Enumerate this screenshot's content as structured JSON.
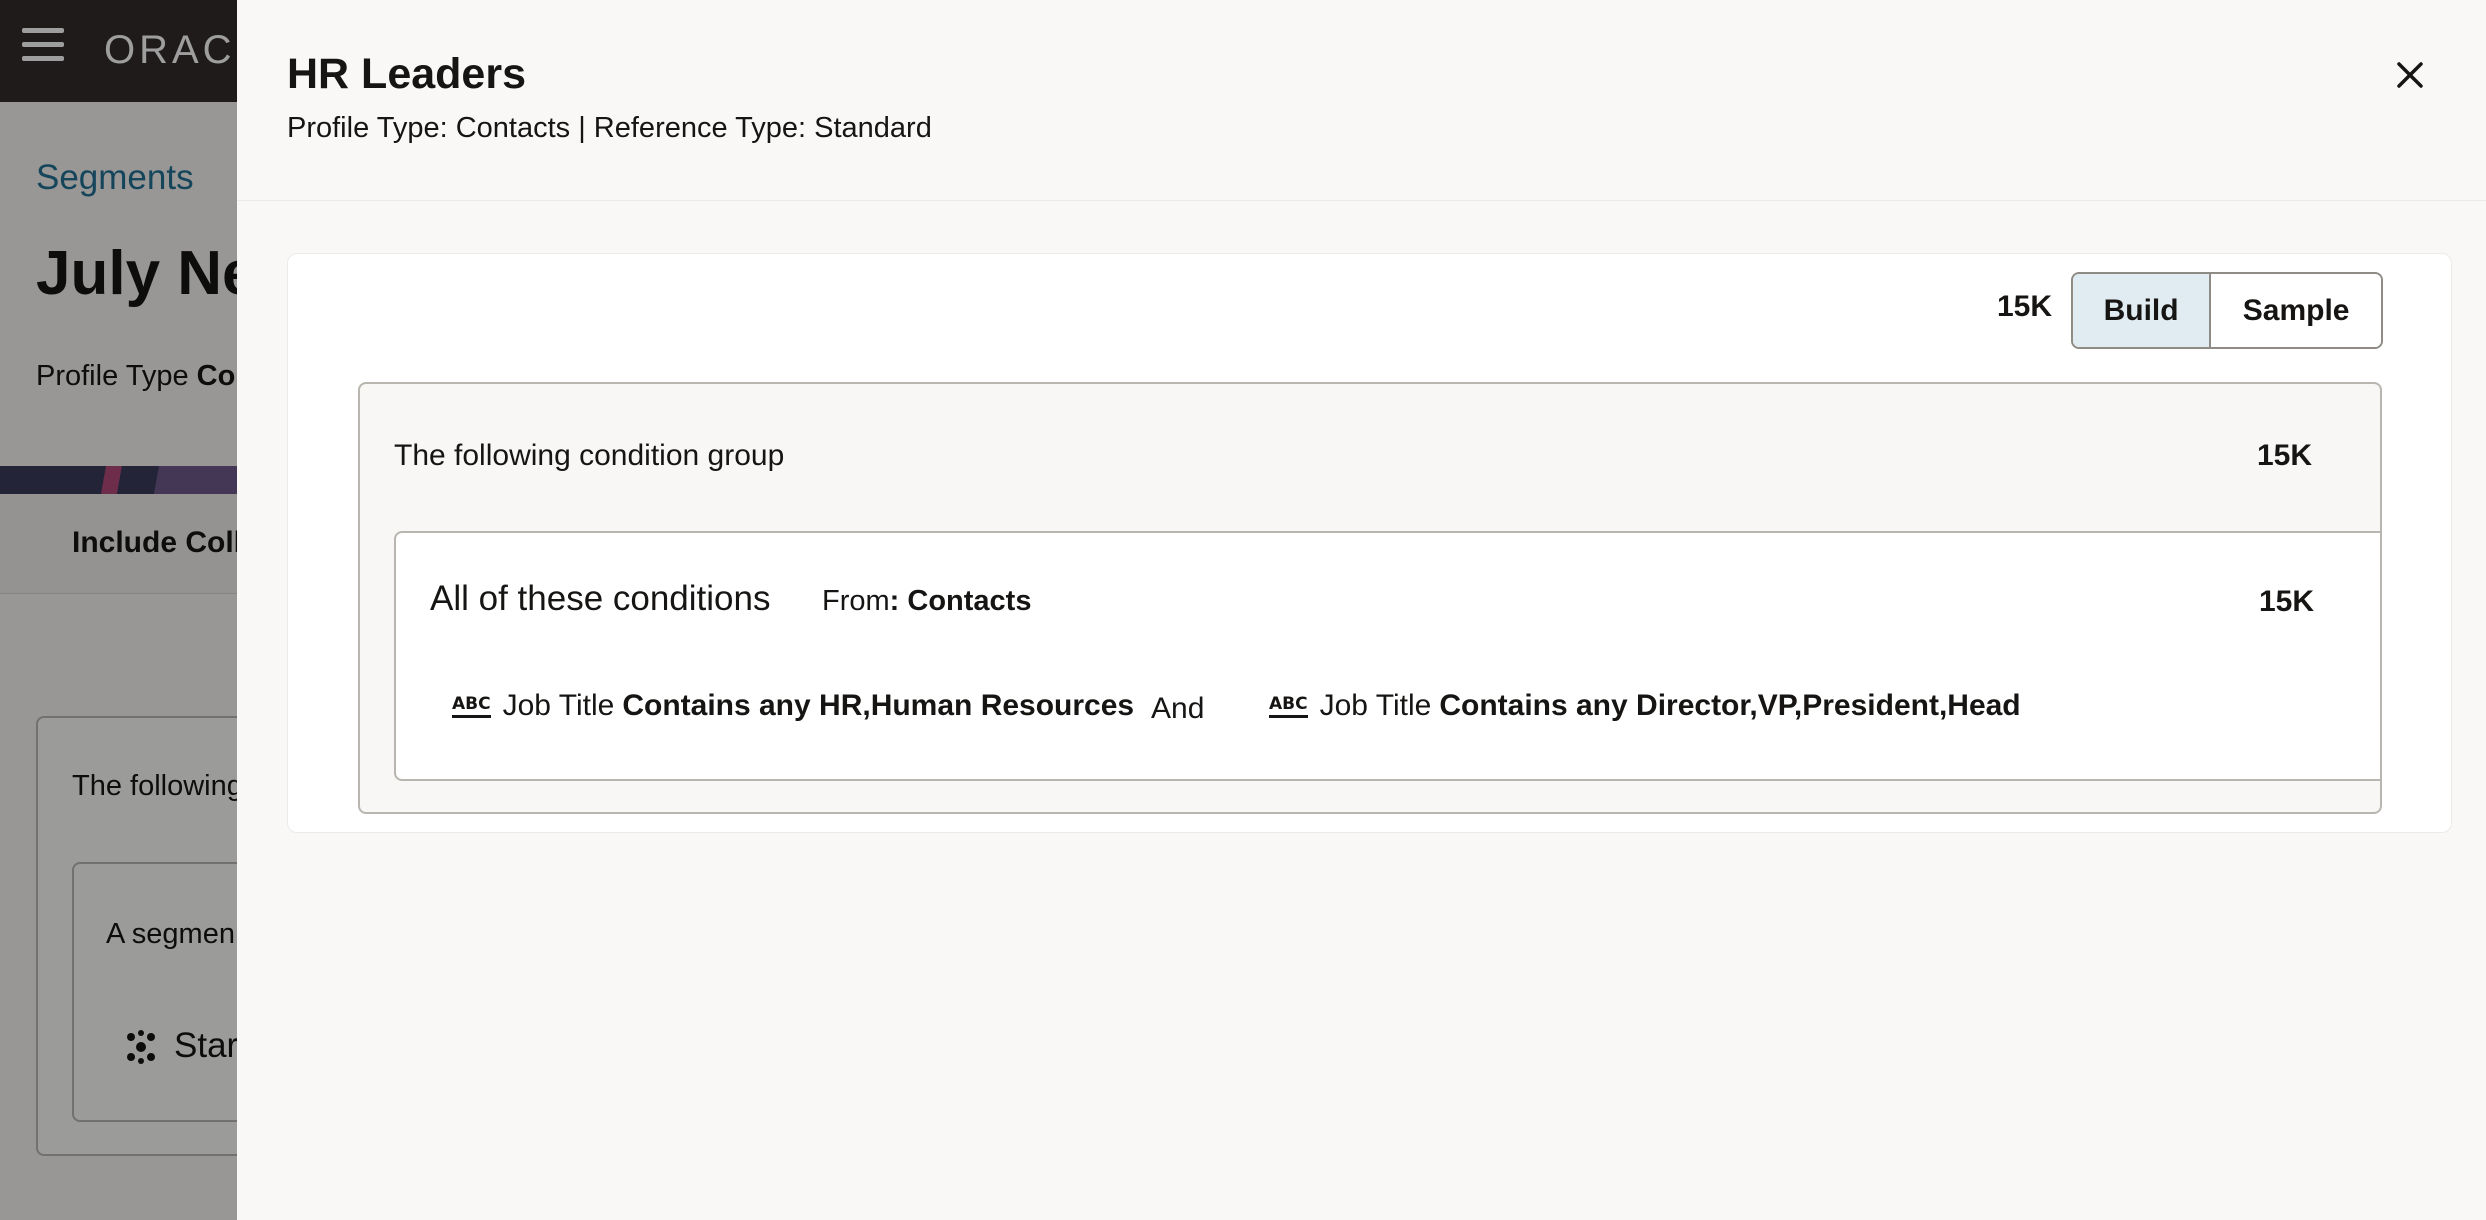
{
  "app": {
    "brand": "ORACLE",
    "breadcrumb": "Segments",
    "page_title": "July Ne",
    "profile_label": "Profile Type",
    "profile_value": "Co",
    "tab_label": "Include Colle",
    "card_text": "The following",
    "inner_text": "A segmen",
    "inner_label": "Star"
  },
  "drawer": {
    "title": "HR Leaders",
    "subtitle": "Profile Type: Contacts | Reference Type: Standard",
    "close_icon": "close-icon"
  },
  "builder": {
    "total_count": "15K",
    "toggle": {
      "build_label": "Build",
      "sample_label": "Sample",
      "selected": "Build"
    },
    "group": {
      "label": "The following condition group",
      "count": "15K",
      "conditions": {
        "title": "All of these conditions",
        "from_label": "From",
        "from_value": ": Contacts",
        "count": "15K",
        "rules": [
          {
            "icon": "text-attribute-icon",
            "icon_text": "ABC",
            "field": "Job Title",
            "expression": "Contains any HR,Human Resources"
          },
          {
            "icon": "text-attribute-icon",
            "icon_text": "ABC",
            "field": "Job Title",
            "expression": "Contains any Director,VP,President,Head"
          }
        ],
        "operator": "And"
      }
    }
  },
  "colors": {
    "topbar": "#312d2a",
    "link": "#227094",
    "toggle_selected": "#e1ecf2"
  }
}
